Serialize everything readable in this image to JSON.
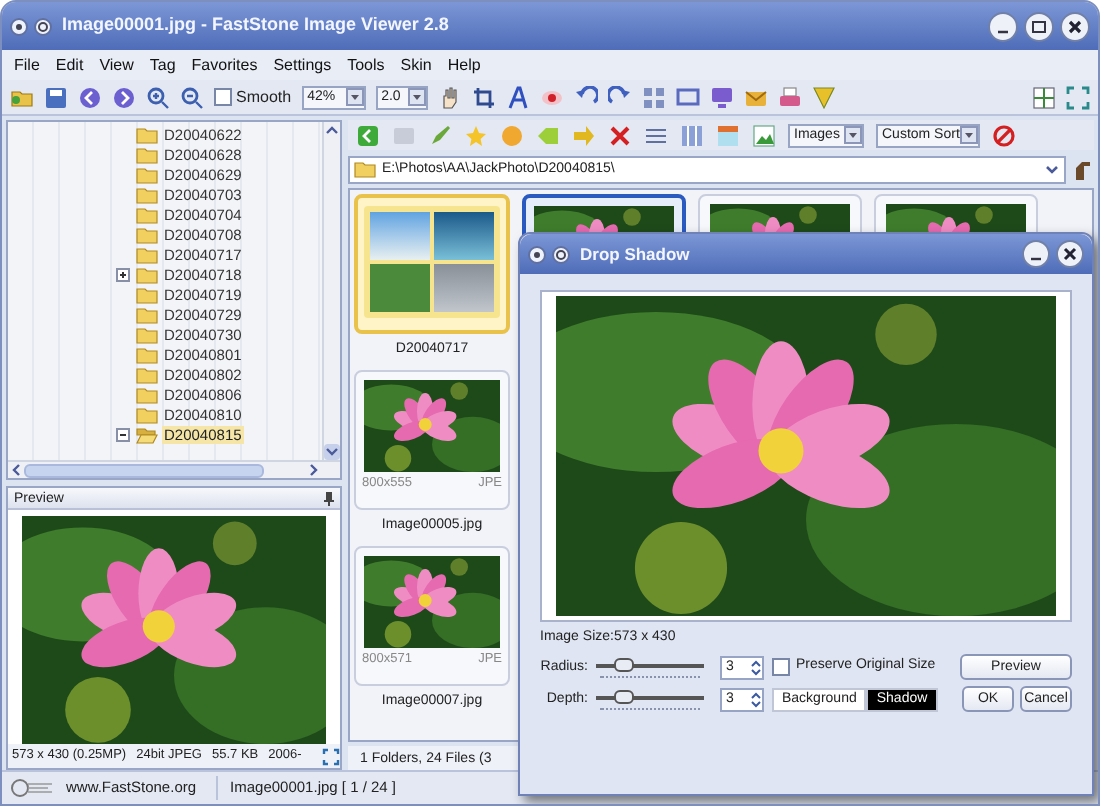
{
  "window": {
    "title": "Image00001.jpg - FastStone Image Viewer 2.8"
  },
  "menu": [
    "File",
    "Edit",
    "View",
    "Tag",
    "Favorites",
    "Settings",
    "Tools",
    "Skin",
    "Help"
  ],
  "toolbar": {
    "smooth": {
      "label": "Smooth",
      "checked": false
    },
    "zoom": "42%",
    "ratio": "2.0"
  },
  "tree": {
    "items": [
      {
        "label": "D20040622",
        "has_children": false,
        "expanded": false,
        "selected": false
      },
      {
        "label": "D20040628",
        "has_children": false,
        "expanded": false,
        "selected": false
      },
      {
        "label": "D20040629",
        "has_children": false,
        "expanded": false,
        "selected": false
      },
      {
        "label": "D20040703",
        "has_children": false,
        "expanded": false,
        "selected": false
      },
      {
        "label": "D20040704",
        "has_children": false,
        "expanded": false,
        "selected": false
      },
      {
        "label": "D20040708",
        "has_children": false,
        "expanded": false,
        "selected": false
      },
      {
        "label": "D20040717",
        "has_children": false,
        "expanded": false,
        "selected": false
      },
      {
        "label": "D20040718",
        "has_children": true,
        "expanded": false,
        "selected": false
      },
      {
        "label": "D20040719",
        "has_children": false,
        "expanded": false,
        "selected": false
      },
      {
        "label": "D20040729",
        "has_children": false,
        "expanded": false,
        "selected": false
      },
      {
        "label": "D20040730",
        "has_children": false,
        "expanded": false,
        "selected": false
      },
      {
        "label": "D20040801",
        "has_children": false,
        "expanded": false,
        "selected": false
      },
      {
        "label": "D20040802",
        "has_children": false,
        "expanded": false,
        "selected": false
      },
      {
        "label": "D20040806",
        "has_children": false,
        "expanded": false,
        "selected": false
      },
      {
        "label": "D20040810",
        "has_children": false,
        "expanded": false,
        "selected": false
      },
      {
        "label": "D20040815",
        "has_children": true,
        "expanded": true,
        "selected": true
      }
    ]
  },
  "preview": {
    "title": "Preview",
    "info": [
      "573 x 430 (0.25MP)",
      "24bit JPEG",
      "55.7 KB",
      "2006-"
    ]
  },
  "browser": {
    "view_filter": "Images",
    "sort": "Custom Sort",
    "path": "E:\\Photos\\AA\\JackPhoto\\D20040815\\",
    "thumbnails": [
      {
        "kind": "folder",
        "caption": "D20040717",
        "selected": true
      },
      {
        "kind": "image",
        "dimensions": "800x555",
        "format": "JPE",
        "caption": "Image00005.jpg",
        "selected": false
      },
      {
        "kind": "image",
        "dimensions": "800x571",
        "format": "JPE",
        "caption": "Image00007.jpg",
        "selected": false
      }
    ],
    "other_thumbnails": [
      {
        "selected": true
      },
      {
        "selected": false
      },
      {
        "selected": false
      }
    ],
    "status": "1 Folders, 24 Files (3"
  },
  "status_bar": {
    "website": "www.FastStone.org",
    "file": "Image00001.jpg [ 1 / 24 ]"
  },
  "dialog": {
    "title": "Drop Shadow",
    "image_size": "Image Size:573 x 430",
    "sliders": [
      {
        "label": "Radius:",
        "level": 0.25,
        "value": "3"
      },
      {
        "label": "Depth:",
        "level": 0.25,
        "value": "3"
      }
    ],
    "preserve": {
      "label": "Preserve Original Size",
      "checked": false
    },
    "colors": [
      {
        "label": "Background",
        "color": "#ffffff"
      },
      {
        "label": "Shadow",
        "color": "#000000"
      }
    ],
    "buttons": [
      "Preview",
      "OK",
      "Cancel"
    ]
  }
}
